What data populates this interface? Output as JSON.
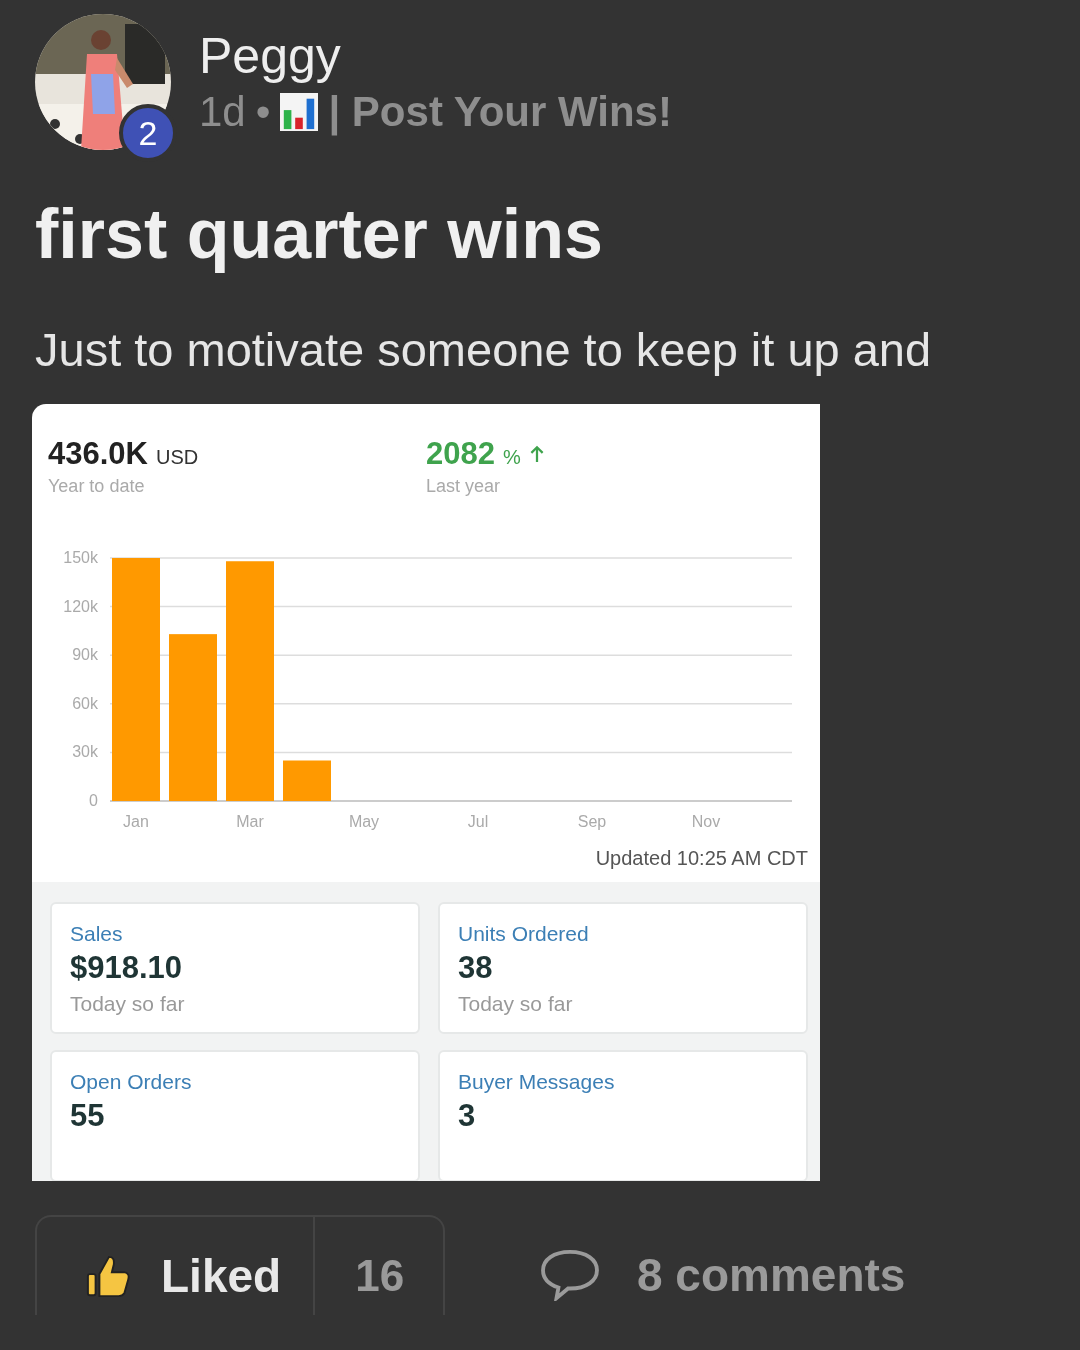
{
  "post": {
    "author": "Peggy",
    "badge": "2",
    "age": "1d",
    "separator": "•",
    "group": "| Post Your Wins!",
    "title": "first quarter wins",
    "body": "Just to motivate someone to keep it up and"
  },
  "screenshot": {
    "summary": [
      {
        "value": "436.0K",
        "unit": "USD",
        "caption": "Year to date",
        "kind": "plain"
      },
      {
        "value": "2082",
        "unit": "%",
        "caption": "Last year",
        "kind": "growth"
      }
    ],
    "chart_data": {
      "type": "bar",
      "categories": [
        "Jan",
        null,
        "Mar",
        null,
        "May",
        null,
        "Jul",
        null,
        "Sep",
        null,
        "Nov",
        null
      ],
      "values": [
        150000,
        103000,
        148000,
        25000,
        null,
        null,
        null,
        null,
        null,
        null,
        null,
        null
      ],
      "ylim": [
        0,
        150000
      ],
      "grid": true,
      "yticks": [
        {
          "value": 0,
          "label": "0"
        },
        {
          "value": 30000,
          "label": "30k"
        },
        {
          "value": 60000,
          "label": "60k"
        },
        {
          "value": 90000,
          "label": "90k"
        },
        {
          "value": 120000,
          "label": "120k"
        },
        {
          "value": 150000,
          "label": "150k"
        }
      ]
    },
    "updated": "Updated 10:25 AM CDT",
    "tiles": [
      {
        "label": "Sales",
        "value": "$918.10",
        "caption": "Today so far"
      },
      {
        "label": "Units Ordered",
        "value": "38",
        "caption": "Today so far"
      },
      {
        "label": "Open Orders",
        "value": "55"
      },
      {
        "label": "Buyer Messages",
        "value": "3"
      }
    ]
  },
  "actions": {
    "like": {
      "label": "Liked",
      "selected": true,
      "count": "16"
    },
    "comments": "8 comments"
  }
}
